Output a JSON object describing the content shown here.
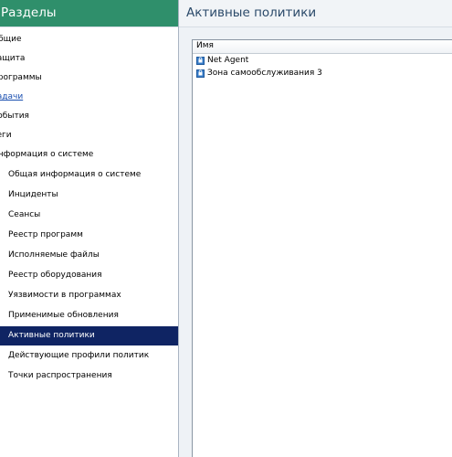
{
  "sidebar": {
    "title": "Разделы",
    "items": [
      {
        "label": "Общие"
      },
      {
        "label": "Защита"
      },
      {
        "label": "Программы"
      },
      {
        "label": "Задачи"
      },
      {
        "label": "События"
      },
      {
        "label": "Теги"
      },
      {
        "label": "Информация о системе"
      },
      {
        "label": "Общая информация о системе"
      },
      {
        "label": "Инциденты"
      },
      {
        "label": "Сеансы"
      },
      {
        "label": "Реестр программ"
      },
      {
        "label": "Исполняемые файлы"
      },
      {
        "label": "Реестр оборудования"
      },
      {
        "label": "Уязвимости в программах"
      },
      {
        "label": "Применимые обновления"
      },
      {
        "label": "Активные политики"
      },
      {
        "label": "Действующие профили политик"
      },
      {
        "label": "Точки распространения"
      }
    ]
  },
  "main": {
    "title": "Активные политики",
    "list": {
      "column_header": "Имя",
      "rows": [
        {
          "name": "Net Agent",
          "icon": "policy-lock-icon"
        },
        {
          "name": "Зона самообслуживания 3",
          "icon": "policy-lock-icon"
        }
      ]
    }
  },
  "colors": {
    "header_green": "#2f8f6b",
    "selected_bg": "#0f2463",
    "link_blue": "#1a4fb0"
  }
}
